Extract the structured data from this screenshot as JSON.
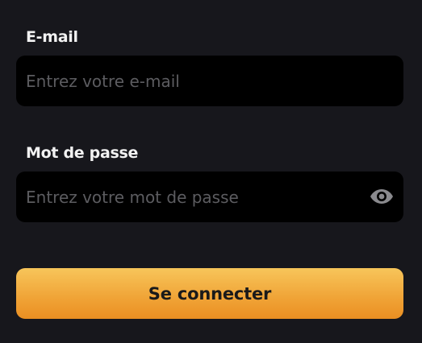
{
  "form": {
    "email": {
      "label": "E-mail",
      "placeholder": "Entrez votre e-mail",
      "value": ""
    },
    "password": {
      "label": "Mot de passe",
      "placeholder": "Entrez votre mot de passe",
      "value": "",
      "toggle_icon": "eye-icon"
    },
    "submit_label": "Se connecter"
  },
  "colors": {
    "background": "#17171c",
    "field_background": "#000000",
    "label": "#f2f2f2",
    "placeholder": "#5c5c60",
    "accent_top": "#f7c55a",
    "accent_bottom": "#ea8f22",
    "icon": "#8a8a8e"
  }
}
